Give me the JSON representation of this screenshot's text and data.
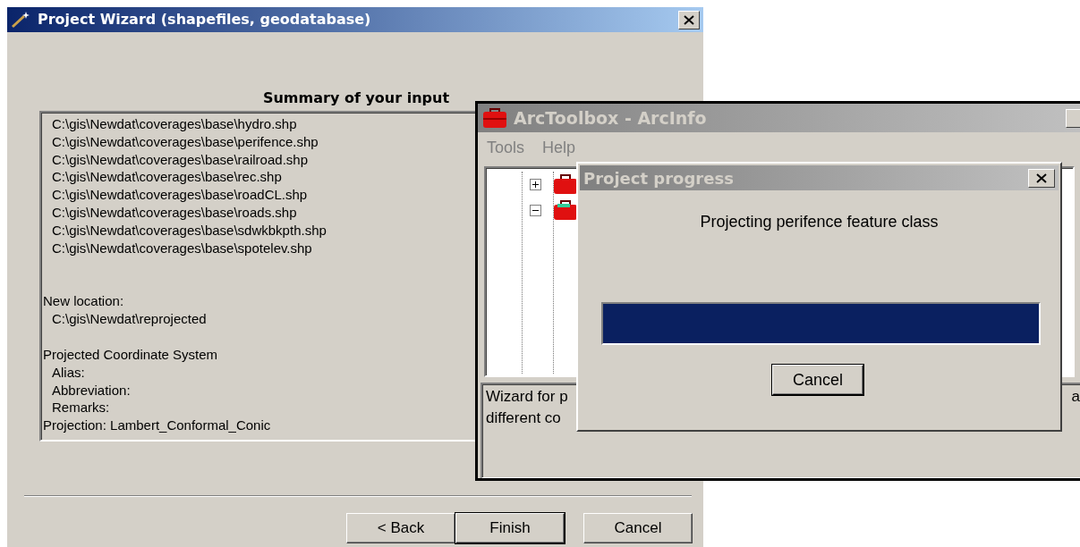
{
  "wizard": {
    "title": "Project Wizard (shapefiles, geodatabase)",
    "heading": "Summary of your input",
    "summary_lines": [
      "C:\\gis\\Newdat\\coverages\\base\\hydro.shp",
      "C:\\gis\\Newdat\\coverages\\base\\perifence.shp",
      "C:\\gis\\Newdat\\coverages\\base\\railroad.shp",
      "C:\\gis\\Newdat\\coverages\\base\\rec.shp",
      "C:\\gis\\Newdat\\coverages\\base\\roadCL.shp",
      "C:\\gis\\Newdat\\coverages\\base\\roads.shp",
      "C:\\gis\\Newdat\\coverages\\base\\sdwkbkpth.shp",
      "C:\\gis\\Newdat\\coverages\\base\\spotelev.shp"
    ],
    "detail_groups": [
      [
        {
          "text": "New location:",
          "indent": false
        },
        {
          "text": "C:\\gis\\Newdat\\reprojected",
          "indent": true
        }
      ],
      [
        {
          "text": "Projected Coordinate System",
          "indent": false
        },
        {
          "text": "Alias:",
          "indent": true
        },
        {
          "text": "Abbreviation:",
          "indent": true
        },
        {
          "text": "Remarks:",
          "indent": true
        },
        {
          "text": "Projection: Lambert_Conformal_Conic",
          "indent": false
        }
      ]
    ],
    "buttons": [
      {
        "label": "< Back",
        "default": false
      },
      {
        "label": "Finish",
        "default": true
      },
      {
        "label": "Cancel",
        "default": false
      }
    ]
  },
  "toolbox": {
    "title": "ArcToolbox - ArcInfo",
    "menu": [
      "Tools",
      "Help"
    ],
    "tree": [
      {
        "expanded": false
      },
      {
        "expanded": true
      }
    ],
    "description": [
      {
        "text": "Wizard for p",
        "kind": "left"
      },
      {
        "text": "a",
        "kind": "right"
      },
      {
        "text": "different co",
        "kind": "left"
      }
    ]
  },
  "progress": {
    "title": "Project progress",
    "message": "Projecting perifence feature class",
    "level": 1,
    "button": "Cancel"
  }
}
